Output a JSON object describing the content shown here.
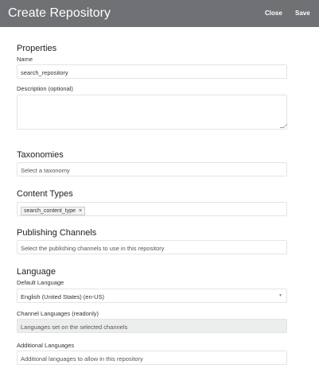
{
  "header": {
    "title": "Create Repository",
    "close_label": "Close",
    "save_label": "Save"
  },
  "properties": {
    "heading": "Properties",
    "name_label": "Name",
    "name_value": "search_repository",
    "description_label": "Description (optional)"
  },
  "taxonomies": {
    "heading": "Taxonomies",
    "placeholder": "Select a taxonomy"
  },
  "content_types": {
    "heading": "Content Types",
    "chips": [
      "search_content_type"
    ],
    "remove_glyph": "×"
  },
  "publishing": {
    "heading": "Publishing Channels",
    "placeholder": "Select the publishing channels to use in this repository"
  },
  "language": {
    "heading": "Language",
    "default_label": "Default Language",
    "default_value": "English (United States) (en-US)",
    "caret": "▼",
    "channel_label": "Channel Languages (readonly)",
    "channel_placeholder": "Languages set on the selected channels",
    "additional_label": "Additional Languages",
    "additional_placeholder": "Additional languages to allow in this repository"
  }
}
